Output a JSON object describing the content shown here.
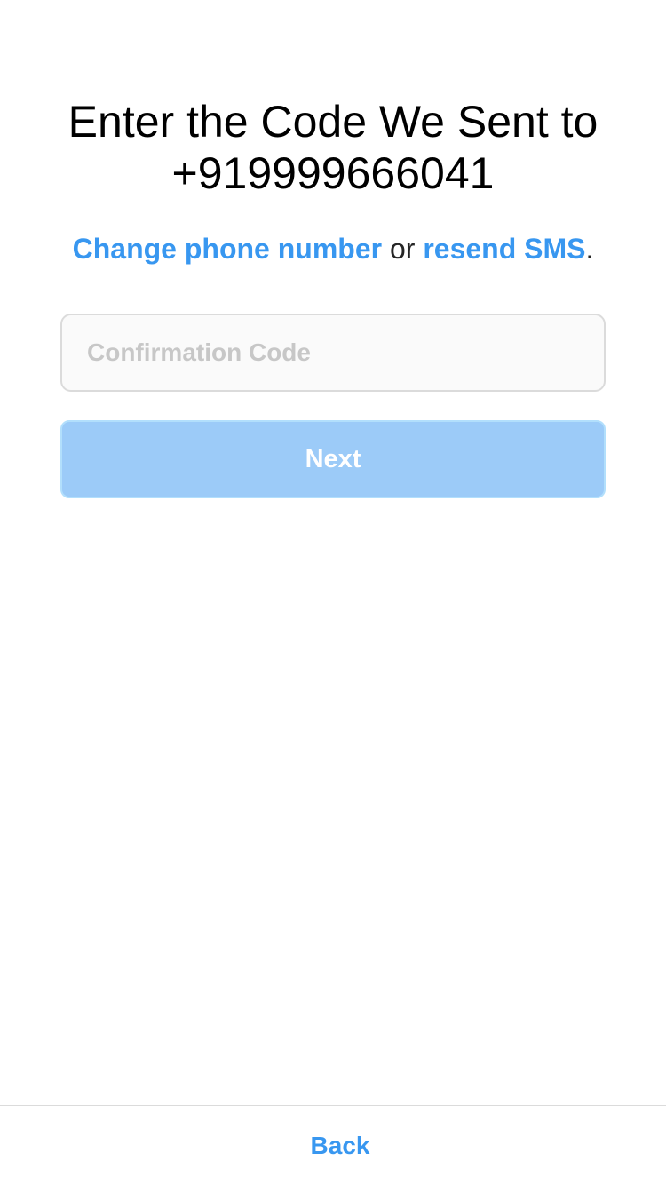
{
  "header": {
    "title_line1": "Enter the Code We Sent to",
    "title_line2": "+919999666041"
  },
  "subline": {
    "change_link": "Change phone number",
    "connector": " or ",
    "resend_link": "resend SMS",
    "end": "."
  },
  "code_field": {
    "value": "",
    "placeholder": "Confirmation Code"
  },
  "actions": {
    "next_label": "Next",
    "back_label": "Back"
  },
  "colors": {
    "link": "#3897f0",
    "button_disabled": "#9ccbf8",
    "field_border": "#dbdbdb",
    "field_background": "#fafafa"
  }
}
